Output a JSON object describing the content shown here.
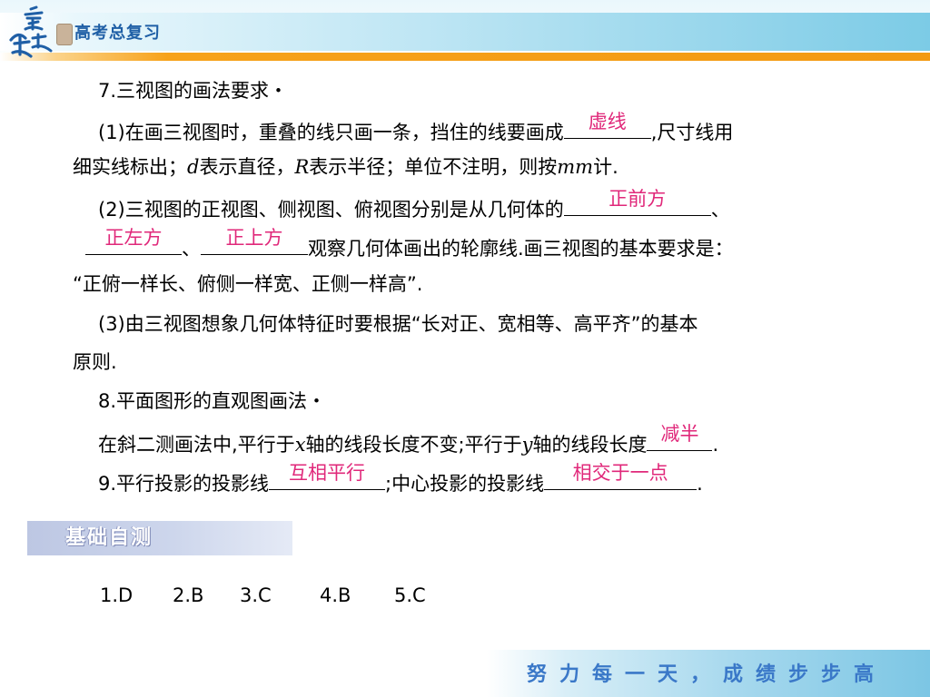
{
  "header": {
    "title": "高考总复习",
    "logo_text": "高考步步"
  },
  "section7": {
    "heading": "7.三视图的画法要求・",
    "p1": {
      "pre": "(1)在画三视图时，重叠的线只画一条，挡住的线要画成",
      "answer": "虚线",
      "post": ",尺寸线用",
      "line2_a": "细实线标出；",
      "var_d": "d",
      "line2_b": "表示直径，",
      "var_r": "R",
      "line2_c": "表示半径；单位不注明，则按",
      "var_mm": "mm",
      "line2_d": "计."
    },
    "p2": {
      "pre": "(2)三视图的正视图、侧视图、俯视图分别是从几何体的",
      "answer1": "正前方",
      "sep1": "、",
      "answer2": "正左方",
      "sep2": "、",
      "answer3": "正上方",
      "post": "观察几何体画出的轮廓线.画三视图的基本要求是：",
      "line3": "“正俯一样长、俯侧一样宽、正侧一样高”."
    },
    "p3": {
      "line1": "(3)由三视图想象几何体特征时要根据“长对正、宽相等、高平齐”的基本",
      "line2": "原则."
    }
  },
  "section8": {
    "heading": "8.平面图形的直观图画法・",
    "pre": "在斜二测画法中,平行于",
    "var_x": "x",
    "mid": "轴的线段长度不变;平行于",
    "var_y": "y",
    "post": "轴的线段长度",
    "answer": "减半",
    "end": "."
  },
  "section9": {
    "pre": "9.平行投影的投影线",
    "answer1": "互相平行",
    "mid": ";中心投影的投影线",
    "answer2": "相交于一点",
    "end": "."
  },
  "banner": {
    "title": "基础自测"
  },
  "answers": [
    "1.D",
    "2.B",
    "3.C",
    "4.B",
    "5.C"
  ],
  "footer": {
    "slogan": "努力每一天，成绩步步高"
  },
  "colors": {
    "answer": "#e0287a",
    "header_blue": "#1f5fa6",
    "orange": "#f39a12",
    "footer_text": "#3a78c8"
  }
}
